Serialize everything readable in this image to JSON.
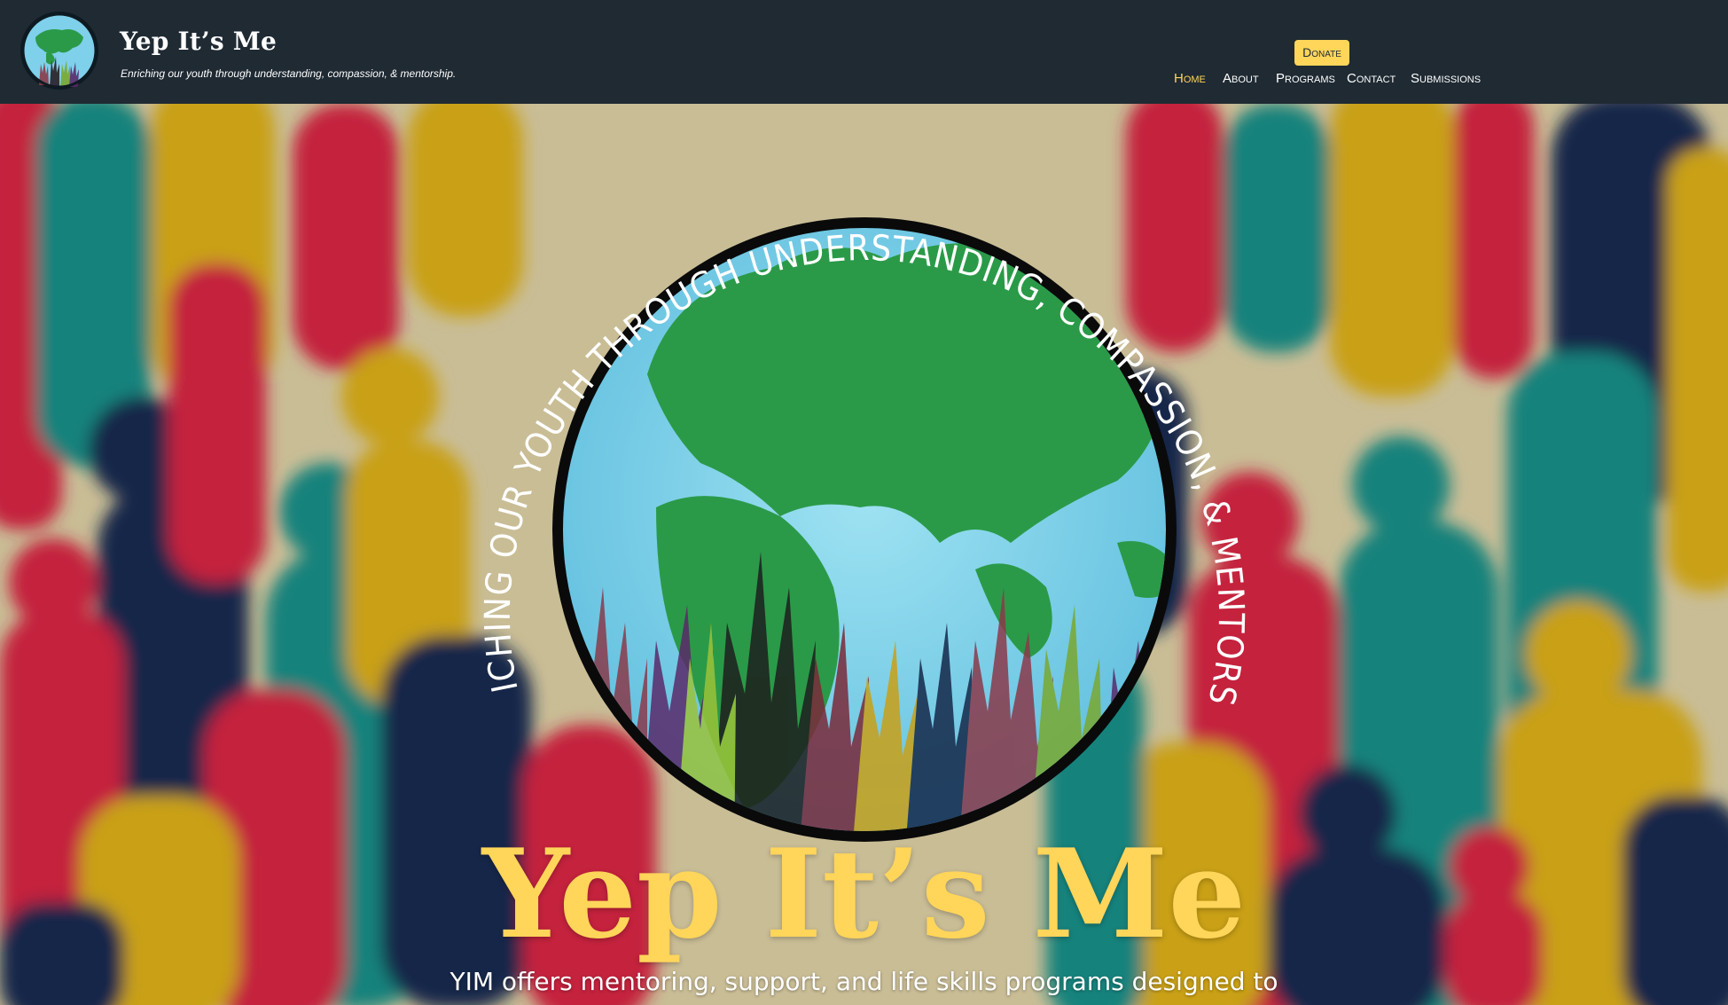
{
  "header": {
    "site_title": "Yep It’s Me",
    "tagline": "Enriching our youth through understanding, compassion, & mentorship.",
    "donate_label": "Donate",
    "nav": [
      {
        "label": "Home",
        "active": true
      },
      {
        "label": "About",
        "active": false
      },
      {
        "label": "Programs",
        "active": false
      },
      {
        "label": "Contact",
        "active": false
      },
      {
        "label": "Submissions",
        "active": false
      }
    ]
  },
  "hero": {
    "arc_text": "ENRICHING OUR YOUTH THROUGH UNDERSTANDING, COMPASSION, & MENTORSHIP",
    "title": "Yep It’s Me",
    "description": "YIM offers mentoring, support, and life skills programs designed to"
  },
  "colors": {
    "header_bg": "#1f2a33",
    "accent_yellow": "#ffd55a",
    "globe_ocean": "#7fd0ea",
    "land_green": "#2a9a48",
    "crowd_red": "#c4213e",
    "crowd_teal": "#18827b",
    "crowd_navy": "#15284a",
    "crowd_mustard": "#c9a018",
    "crowd_beige": "#c9bd96"
  },
  "icons": {
    "logo": "globe-hands-logo-icon",
    "emblem": "globe-hands-emblem-icon"
  }
}
